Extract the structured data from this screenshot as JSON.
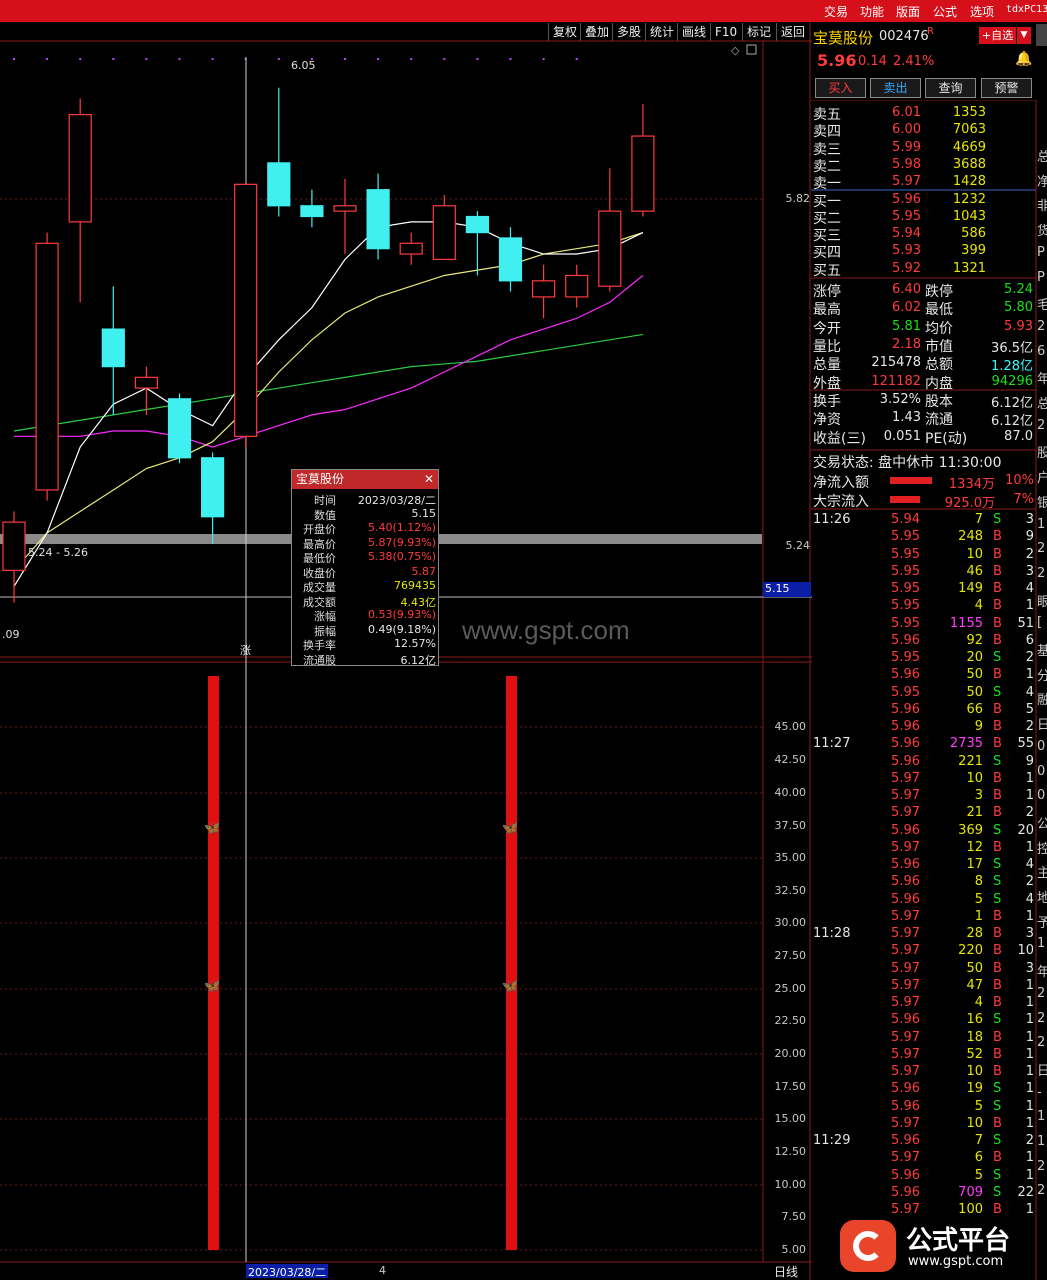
{
  "topbar": {
    "menu": [
      "交易",
      "功能",
      "版面",
      "公式",
      "选项"
    ],
    "title": "tdxPC13"
  },
  "toolbar": [
    "复权",
    "叠加",
    "多股",
    "统计",
    "画线",
    "F10",
    "标记",
    "返回"
  ],
  "price_axis": [
    "5.82",
    "5.24",
    "5.15"
  ],
  "indicator_axis": [
    "45.00",
    "42.50",
    "40.00",
    "37.50",
    "35.00",
    "32.50",
    "30.00",
    "27.50",
    "25.00",
    "22.50",
    "20.00",
    "17.50",
    "15.00",
    "12.50",
    "10.00",
    "7.50",
    "5.00"
  ],
  "chart_labels": {
    "high_mark": "6.05",
    "range_label": "5.24 - 5.26",
    "low_mark": ".09",
    "watermark": "www.gspt.com",
    "bottom_date": "2023/03/28/二",
    "bottom_num": "4",
    "period": "日线",
    "rise_mark": "涨"
  },
  "chart_data": {
    "type": "candlestick",
    "candles": [
      {
        "o": 5.15,
        "c": 5.24,
        "h": 5.26,
        "l": 5.09
      },
      {
        "o": 5.3,
        "c": 5.76,
        "h": 5.78,
        "l": 5.28
      },
      {
        "o": 5.8,
        "c": 6.0,
        "h": 6.03,
        "l": 5.65
      },
      {
        "o": 5.6,
        "c": 5.53,
        "h": 5.68,
        "l": 5.44
      },
      {
        "o": 5.49,
        "c": 5.51,
        "h": 5.53,
        "l": 5.44
      },
      {
        "o": 5.47,
        "c": 5.36,
        "h": 5.48,
        "l": 5.35
      },
      {
        "o": 5.36,
        "c": 5.25,
        "h": 5.37,
        "l": 5.2
      },
      {
        "o": 5.4,
        "c": 5.87,
        "h": 5.87,
        "l": 5.38
      },
      {
        "o": 5.91,
        "c": 5.83,
        "h": 6.05,
        "l": 5.81
      },
      {
        "o": 5.83,
        "c": 5.81,
        "h": 5.86,
        "l": 5.79
      },
      {
        "o": 5.82,
        "c": 5.83,
        "h": 5.88,
        "l": 5.74
      },
      {
        "o": 5.86,
        "c": 5.75,
        "h": 5.89,
        "l": 5.73
      },
      {
        "o": 5.74,
        "c": 5.76,
        "h": 5.78,
        "l": 5.72
      },
      {
        "o": 5.73,
        "c": 5.83,
        "h": 5.85,
        "l": 5.73
      },
      {
        "o": 5.81,
        "c": 5.78,
        "h": 5.82,
        "l": 5.7
      },
      {
        "o": 5.77,
        "c": 5.69,
        "h": 5.79,
        "l": 5.67
      },
      {
        "o": 5.66,
        "c": 5.69,
        "h": 5.72,
        "l": 5.62
      },
      {
        "o": 5.66,
        "c": 5.7,
        "h": 5.72,
        "l": 5.64
      },
      {
        "o": 5.68,
        "c": 5.82,
        "h": 5.9,
        "l": 5.67
      },
      {
        "o": 5.82,
        "c": 5.96,
        "h": 6.02,
        "l": 5.81
      }
    ],
    "ma_white": [
      5.12,
      5.22,
      5.38,
      5.46,
      5.49,
      5.45,
      5.42,
      5.51,
      5.58,
      5.64,
      5.73,
      5.79,
      5.8,
      5.8,
      5.79,
      5.76,
      5.74,
      5.74,
      5.75,
      5.78
    ],
    "ma_yellow": [
      5.15,
      5.22,
      5.26,
      5.3,
      5.34,
      5.36,
      5.39,
      5.45,
      5.52,
      5.58,
      5.63,
      5.66,
      5.68,
      5.7,
      5.71,
      5.72,
      5.74,
      5.75,
      5.76,
      5.78
    ],
    "ma_magenta": [
      5.4,
      5.4,
      5.4,
      5.41,
      5.41,
      5.4,
      5.38,
      5.4,
      5.42,
      5.44,
      5.45,
      5.47,
      5.49,
      5.52,
      5.55,
      5.58,
      5.6,
      5.62,
      5.65,
      5.7
    ],
    "ma_green": [
      5.41,
      5.42,
      5.43,
      5.44,
      5.45,
      5.46,
      5.47,
      5.48,
      5.49,
      5.5,
      5.51,
      5.52,
      5.53,
      5.535,
      5.54,
      5.55,
      5.56,
      5.57,
      5.58,
      5.59
    ],
    "ylim": [
      5.05,
      6.1
    ],
    "indicator_bars": [
      {
        "index": 6,
        "value": 45.0
      },
      {
        "index": 15,
        "value": 45.0
      }
    ]
  },
  "stock": {
    "name": "宝莫股份",
    "code": "002476",
    "badge": "R",
    "add_btn": "+自选",
    "price": "5.96",
    "change": "0.14",
    "pct": "2.41%"
  },
  "actions": [
    "买入",
    "卖出",
    "查询",
    "预警"
  ],
  "order_book": [
    {
      "label": "卖五",
      "price": "6.01",
      "vol": "1353"
    },
    {
      "label": "卖四",
      "price": "6.00",
      "vol": "7063"
    },
    {
      "label": "卖三",
      "price": "5.99",
      "vol": "4669"
    },
    {
      "label": "卖二",
      "price": "5.98",
      "vol": "3688"
    },
    {
      "label": "卖一",
      "price": "5.97",
      "vol": "1428"
    },
    {
      "label": "买一",
      "price": "5.96",
      "vol": "1232"
    },
    {
      "label": "买二",
      "price": "5.95",
      "vol": "1043"
    },
    {
      "label": "买三",
      "price": "5.94",
      "vol": "586"
    },
    {
      "label": "买四",
      "price": "5.93",
      "vol": "399"
    },
    {
      "label": "买五",
      "price": "5.92",
      "vol": "1321"
    }
  ],
  "stats": [
    {
      "l1": "涨停",
      "v1": "6.40",
      "c1": "r",
      "l2": "跌停",
      "v2": "5.24",
      "c2": "g"
    },
    {
      "l1": "最高",
      "v1": "6.02",
      "c1": "r",
      "l2": "最低",
      "v2": "5.80",
      "c2": "g"
    },
    {
      "l1": "今开",
      "v1": "5.81",
      "c1": "g",
      "l2": "均价",
      "v2": "5.93",
      "c2": "r"
    },
    {
      "l1": "量比",
      "v1": "2.18",
      "c1": "r",
      "l2": "市值",
      "v2": "36.5亿",
      "c2": "w"
    },
    {
      "l1": "总量",
      "v1": "215478",
      "c1": "w",
      "l2": "总额",
      "v2": "1.28亿",
      "c2": "c"
    },
    {
      "l1": "外盘",
      "v1": "121182",
      "c1": "r",
      "l2": "内盘",
      "v2": "94296",
      "c2": "g"
    }
  ],
  "stats2": [
    {
      "l1": "换手",
      "v1": "3.52%",
      "l2": "股本",
      "v2": "6.12亿"
    },
    {
      "l1": "净资",
      "v1": "1.43",
      "l2": "流通",
      "v2": "6.12亿"
    },
    {
      "l1": "收益(三)",
      "v1": "0.051",
      "l2": "PE(动)",
      "v2": "87.0"
    }
  ],
  "trade_status": "交易状态: 盘中休市 11:30:00",
  "flows": [
    {
      "label": "净流入额",
      "value": "1334万",
      "pct": "10%"
    },
    {
      "label": "大宗流入",
      "value": "925.0万",
      "pct": "7%"
    }
  ],
  "ticks": [
    {
      "t": "11:26",
      "p": "5.94",
      "v": "7",
      "s": "S",
      "n": "3"
    },
    {
      "t": "",
      "p": "5.95",
      "v": "248",
      "s": "B",
      "n": "9"
    },
    {
      "t": "",
      "p": "5.95",
      "v": "10",
      "s": "B",
      "n": "2"
    },
    {
      "t": "",
      "p": "5.95",
      "v": "46",
      "s": "B",
      "n": "3"
    },
    {
      "t": "",
      "p": "5.95",
      "v": "149",
      "s": "B",
      "n": "4"
    },
    {
      "t": "",
      "p": "5.95",
      "v": "4",
      "s": "B",
      "n": "1"
    },
    {
      "t": "",
      "p": "5.95",
      "v": "1155",
      "s": "B",
      "n": "51"
    },
    {
      "t": "",
      "p": "5.96",
      "v": "92",
      "s": "B",
      "n": "6"
    },
    {
      "t": "",
      "p": "5.95",
      "v": "20",
      "s": "S",
      "n": "2"
    },
    {
      "t": "",
      "p": "5.96",
      "v": "50",
      "s": "B",
      "n": "1"
    },
    {
      "t": "",
      "p": "5.95",
      "v": "50",
      "s": "S",
      "n": "4"
    },
    {
      "t": "",
      "p": "5.96",
      "v": "66",
      "s": "B",
      "n": "5"
    },
    {
      "t": "",
      "p": "5.96",
      "v": "9",
      "s": "B",
      "n": "2"
    },
    {
      "t": "11:27",
      "p": "5.96",
      "v": "2735",
      "s": "B",
      "n": "55"
    },
    {
      "t": "",
      "p": "5.96",
      "v": "221",
      "s": "S",
      "n": "9"
    },
    {
      "t": "",
      "p": "5.97",
      "v": "10",
      "s": "B",
      "n": "1"
    },
    {
      "t": "",
      "p": "5.97",
      "v": "3",
      "s": "B",
      "n": "1"
    },
    {
      "t": "",
      "p": "5.97",
      "v": "21",
      "s": "B",
      "n": "2"
    },
    {
      "t": "",
      "p": "5.96",
      "v": "369",
      "s": "S",
      "n": "20"
    },
    {
      "t": "",
      "p": "5.97",
      "v": "12",
      "s": "B",
      "n": "1"
    },
    {
      "t": "",
      "p": "5.96",
      "v": "17",
      "s": "S",
      "n": "4"
    },
    {
      "t": "",
      "p": "5.96",
      "v": "8",
      "s": "S",
      "n": "2"
    },
    {
      "t": "",
      "p": "5.96",
      "v": "5",
      "s": "S",
      "n": "4"
    },
    {
      "t": "",
      "p": "5.97",
      "v": "1",
      "s": "B",
      "n": "1"
    },
    {
      "t": "11:28",
      "p": "5.97",
      "v": "28",
      "s": "B",
      "n": "3"
    },
    {
      "t": "",
      "p": "5.97",
      "v": "220",
      "s": "B",
      "n": "10"
    },
    {
      "t": "",
      "p": "5.97",
      "v": "50",
      "s": "B",
      "n": "3"
    },
    {
      "t": "",
      "p": "5.97",
      "v": "47",
      "s": "B",
      "n": "1"
    },
    {
      "t": "",
      "p": "5.97",
      "v": "4",
      "s": "B",
      "n": "1"
    },
    {
      "t": "",
      "p": "5.96",
      "v": "16",
      "s": "S",
      "n": "1"
    },
    {
      "t": "",
      "p": "5.97",
      "v": "18",
      "s": "B",
      "n": "1"
    },
    {
      "t": "",
      "p": "5.97",
      "v": "52",
      "s": "B",
      "n": "1"
    },
    {
      "t": "",
      "p": "5.97",
      "v": "10",
      "s": "B",
      "n": "1"
    },
    {
      "t": "",
      "p": "5.96",
      "v": "19",
      "s": "S",
      "n": "1"
    },
    {
      "t": "",
      "p": "5.96",
      "v": "5",
      "s": "S",
      "n": "1"
    },
    {
      "t": "",
      "p": "5.97",
      "v": "10",
      "s": "B",
      "n": "1"
    },
    {
      "t": "11:29",
      "p": "5.96",
      "v": "7",
      "s": "S",
      "n": "2"
    },
    {
      "t": "",
      "p": "5.97",
      "v": "6",
      "s": "B",
      "n": "1"
    },
    {
      "t": "",
      "p": "5.96",
      "v": "5",
      "s": "S",
      "n": "1"
    },
    {
      "t": "",
      "p": "5.96",
      "v": "709",
      "s": "S",
      "n": "22"
    },
    {
      "t": "",
      "p": "5.97",
      "v": "100",
      "s": "B",
      "n": "1"
    }
  ],
  "far_right": [
    "总",
    "净",
    "非",
    "货",
    "P",
    "P",
    "毛",
    "2",
    "6",
    "年",
    "总",
    "2",
    "股",
    "户",
    "银",
    "1",
    "2",
    "2",
    "眼",
    "[",
    "基",
    "分",
    "融",
    "日",
    "0",
    "0",
    "0",
    "公",
    "控",
    "主",
    "地",
    "予",
    "1",
    "年",
    "2",
    "2",
    "2",
    "日",
    "-",
    "1",
    "1",
    "2",
    "2"
  ],
  "popup": {
    "title": "宝莫股份",
    "rows": [
      {
        "label": "时间",
        "value": "2023/03/28/二",
        "color": "w"
      },
      {
        "label": "数值",
        "value": "5.15",
        "color": "w"
      },
      {
        "label": "开盘价",
        "value": "5.40(1.12%)",
        "color": "r"
      },
      {
        "label": "最高价",
        "value": "5.87(9.93%)",
        "color": "r"
      },
      {
        "label": "最低价",
        "value": "5.38(0.75%)",
        "color": "r"
      },
      {
        "label": "收盘价",
        "value": "5.87",
        "color": "r"
      },
      {
        "label": "成交量",
        "value": "769435",
        "color": "y"
      },
      {
        "label": "成交额",
        "value": "4.43亿",
        "color": "y"
      },
      {
        "label": "涨幅",
        "value": "0.53(9.93%)",
        "color": "r"
      },
      {
        "label": "振幅",
        "value": "0.49(9.18%)",
        "color": "w"
      },
      {
        "label": "换手率",
        "value": "12.57%",
        "color": "w"
      },
      {
        "label": "流通股",
        "value": "6.12亿",
        "color": "w"
      }
    ]
  },
  "logo": {
    "text": "公式平台",
    "url": "www.gspt.com"
  }
}
